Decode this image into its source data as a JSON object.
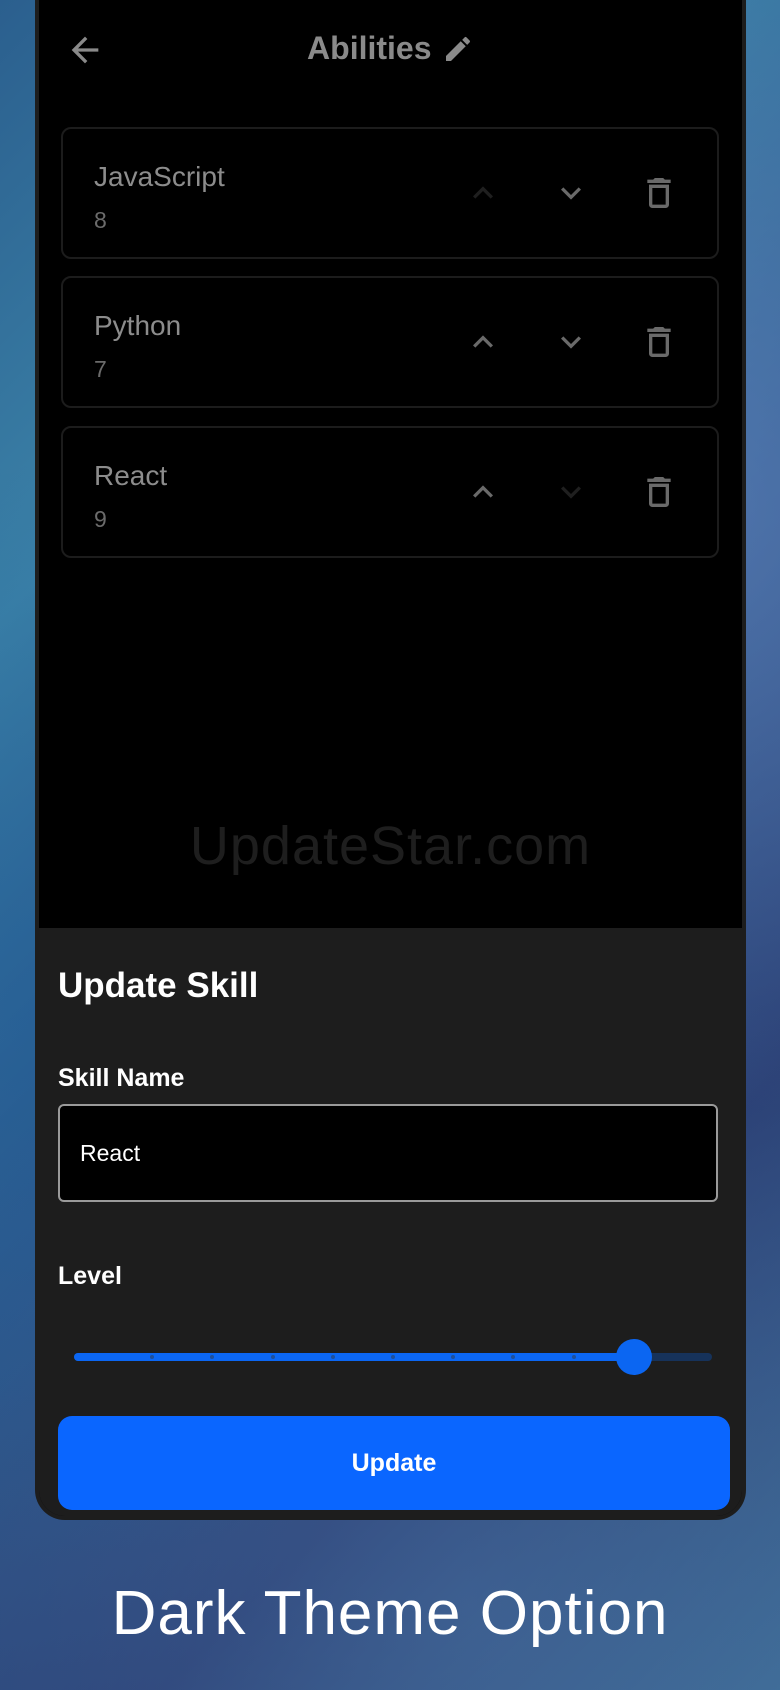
{
  "appbar": {
    "title": "Abilities",
    "back_icon": "arrow-left-icon",
    "edit_icon": "pencil-icon"
  },
  "skills": [
    {
      "name": "JavaScript",
      "level": "8"
    },
    {
      "name": "Python",
      "level": "7"
    },
    {
      "name": "React",
      "level": "9"
    }
  ],
  "watermark": "UpdateStar.com",
  "sheet": {
    "title": "Update Skill",
    "name_label": "Skill Name",
    "name_value": "React",
    "level_label": "Level",
    "level_value": 9,
    "level_max": 10,
    "button_label": "Update"
  },
  "caption": "Dark Theme Option",
  "colors": {
    "accent": "#0a66ff",
    "sheet_bg": "#1d1d1d",
    "card_border": "#1c1c1c"
  }
}
